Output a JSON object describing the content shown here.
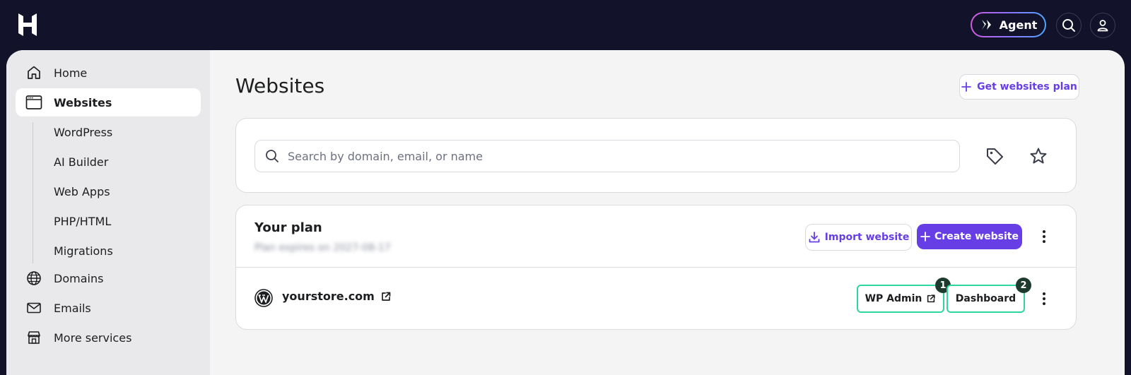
{
  "topbar": {
    "logo": "hostinger-logo",
    "agent_label": "Agent",
    "search_icon": "search-icon",
    "account_icon": "user-icon"
  },
  "sidebar": {
    "items": [
      {
        "label": "Home",
        "icon": "home-icon"
      },
      {
        "label": "Websites",
        "icon": "browser-window-icon",
        "active": true
      },
      {
        "label": "Domains",
        "icon": "globe-icon"
      },
      {
        "label": "Emails",
        "icon": "mail-icon"
      },
      {
        "label": "More services",
        "icon": "store-icon"
      }
    ],
    "subitems": [
      "WordPress",
      "AI Builder",
      "Web Apps",
      "PHP/HTML",
      "Migrations"
    ]
  },
  "main": {
    "title": "Websites",
    "get_plan_label": "Get websites plan",
    "search": {
      "placeholder": "Search by domain, email, or name",
      "value": ""
    },
    "plan": {
      "title": "Your plan",
      "subtitle": "Plan expires on 2027-08-17",
      "import_label": "Import website",
      "create_label": "Create website"
    },
    "site": {
      "domain": "yourstore.com",
      "wp_admin_label": "WP Admin",
      "dashboard_label": "Dashboard",
      "badge_1": "1",
      "badge_2": "2"
    }
  },
  "colors": {
    "topbar": "#12122b",
    "accent": "#673de6",
    "highlight": "#2fd6a0",
    "badge": "#1c3a2e"
  }
}
